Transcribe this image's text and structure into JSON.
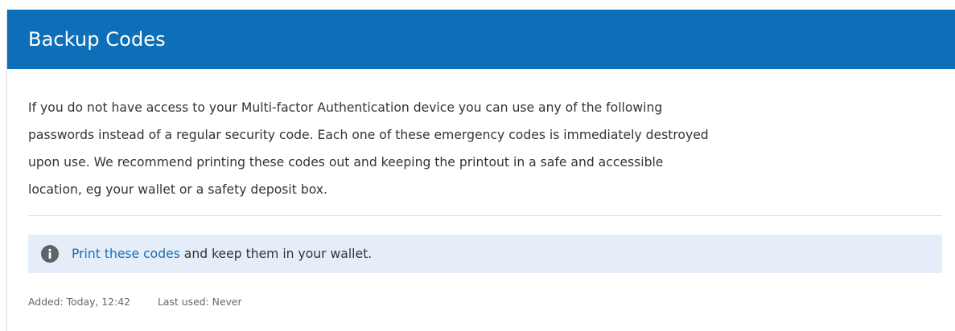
{
  "header": {
    "title": "Backup Codes"
  },
  "description": {
    "lines": [
      "If you do not have access to your Multi-factor Authentication device you can use any of the following",
      "passwords instead of a regular security code. Each one of these emergency codes is immediately destroyed",
      "upon use. We recommend printing these codes out and keeping the printout in a safe and accessible",
      "location, eg your wallet or a safety deposit box."
    ]
  },
  "notice": {
    "icon": "info-icon",
    "link_text": "Print these codes",
    "rest_text": " and keep them in your wallet.",
    "link_color": "#1a6db5",
    "background": "#e5eef8"
  },
  "meta": {
    "added": "Added: Today, 12:42",
    "last_used": "Last used: Never"
  },
  "colors": {
    "header_bg": "#0d6fb8"
  }
}
